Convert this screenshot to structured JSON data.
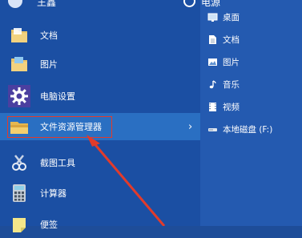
{
  "top": {
    "user_name": "王鑫",
    "power_label": "电源"
  },
  "left_items": [
    {
      "label": "文档",
      "icon": "folder-icon"
    },
    {
      "label": "图片",
      "icon": "pictures-folder-icon"
    },
    {
      "label": "电脑设置",
      "icon": "gear-icon"
    },
    {
      "label": "文件资源管理器",
      "icon": "file-explorer-icon",
      "has_submenu": true,
      "chevron": "›"
    },
    {
      "label": "截图工具",
      "icon": "snipping-tool-icon"
    },
    {
      "label": "计算器",
      "icon": "calculator-icon"
    },
    {
      "label": "便签",
      "icon": "sticky-notes-icon"
    }
  ],
  "right_items": [
    {
      "label": "桌面",
      "icon": "desktop-icon"
    },
    {
      "label": "文档",
      "icon": "document-icon"
    },
    {
      "label": "图片",
      "icon": "picture-icon"
    },
    {
      "label": "音乐",
      "icon": "music-icon"
    },
    {
      "label": "视频",
      "icon": "video-icon"
    },
    {
      "label": "本地磁盘 (F:)",
      "icon": "drive-icon"
    }
  ],
  "colors": {
    "left_bg": "#1b4fa3",
    "right_bg": "#245ab0",
    "active_bg": "#2a6fc2",
    "annotation_red": "#e23b2b"
  }
}
